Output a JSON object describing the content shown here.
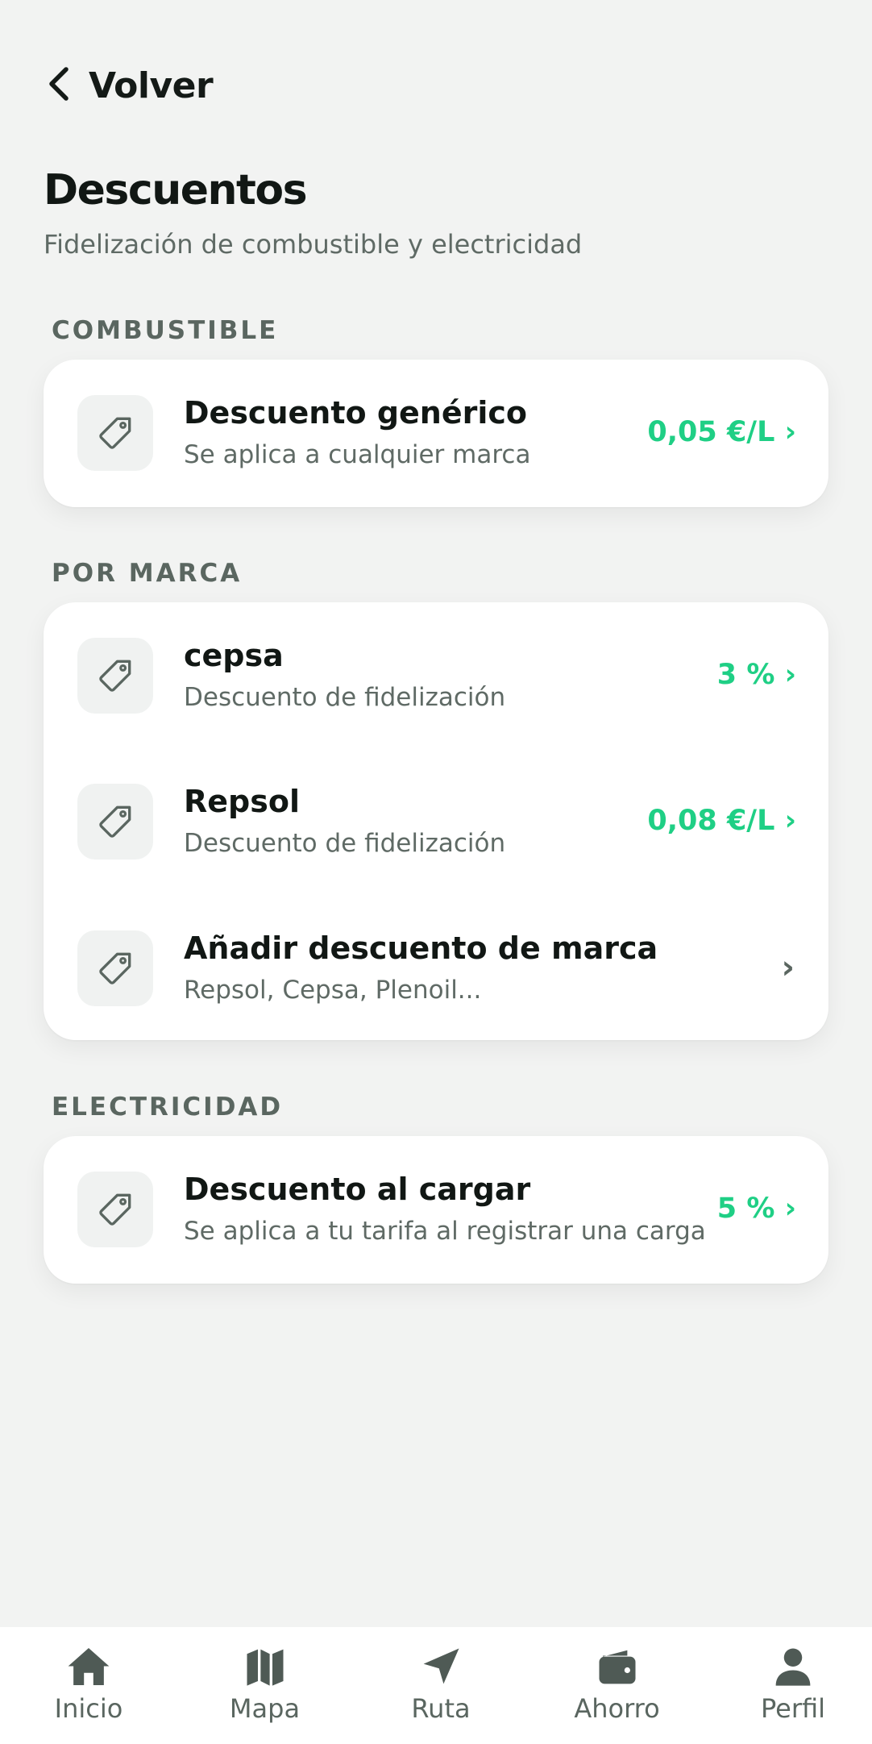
{
  "header": {
    "back_label": "Volver"
  },
  "page": {
    "title": "Descuentos",
    "subtitle": "Fidelización de combustible y electricidad"
  },
  "sections": [
    {
      "label": "COMBUSTIBLE",
      "items": [
        {
          "title": "Descuento genérico",
          "subtitle": "Se aplica a cualquier marca",
          "value": "0,05 €/L ›"
        }
      ]
    },
    {
      "label": "POR MARCA",
      "items": [
        {
          "title": "cepsa",
          "subtitle": "Descuento de fidelización",
          "value": "3 % ›"
        },
        {
          "title": "Repsol",
          "subtitle": "Descuento de fidelización",
          "value": "0,08 €/L ›"
        },
        {
          "title": "Añadir descuento de marca",
          "subtitle": "Repsol, Cepsa, Plenoil...",
          "value": "›"
        }
      ]
    },
    {
      "label": "ELECTRICIDAD",
      "items": [
        {
          "title": "Descuento al cargar",
          "subtitle": "Se aplica a tu tarifa al registrar una carga",
          "value": "5 % ›"
        }
      ]
    }
  ],
  "tabbar": {
    "tabs": [
      {
        "label": "Inicio",
        "icon": "home-icon"
      },
      {
        "label": "Mapa",
        "icon": "map-icon"
      },
      {
        "label": "Ruta",
        "icon": "navigation-arrow-icon"
      },
      {
        "label": "Ahorro",
        "icon": "wallet-icon"
      },
      {
        "label": "Perfil",
        "icon": "person-icon"
      }
    ]
  },
  "colors": {
    "accent": "#1fcf85",
    "background": "#f2f3f2",
    "muted": "#5f6a65",
    "card": "#ffffff"
  }
}
